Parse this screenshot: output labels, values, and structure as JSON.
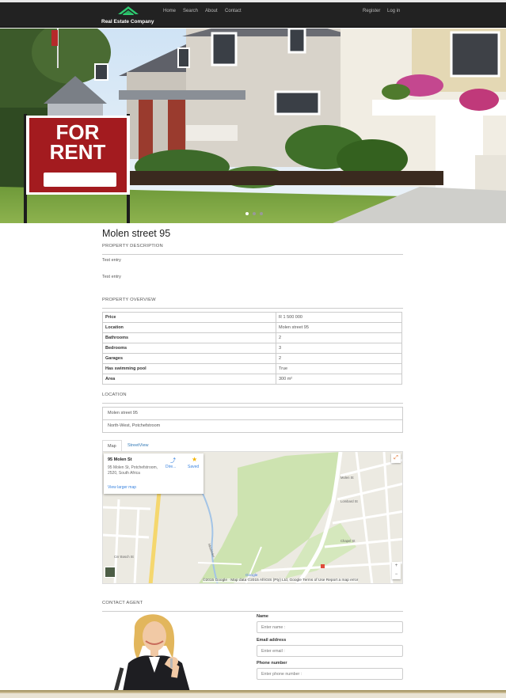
{
  "navbar": {
    "brand": "Real Estate Company",
    "links": [
      "Home",
      "Search",
      "About",
      "Contact"
    ],
    "right_links": [
      "Register",
      "Log in"
    ]
  },
  "hero": {
    "sign_line1": "FOR",
    "sign_line2": "RENT",
    "slide_count": 3,
    "active_slide": 1
  },
  "property": {
    "title": "Molen street 95",
    "description_heading": "PROPERTY DESCRIPTION",
    "description_lines": [
      "Test entry",
      "Test entry"
    ],
    "overview_heading": "PROPERTY OVERVIEW",
    "overview": [
      {
        "label": "Price",
        "value": "R 1 500 000"
      },
      {
        "label": "Location",
        "value": "Molen street 95"
      },
      {
        "label": "Bathrooms",
        "value": "2"
      },
      {
        "label": "Bedrooms",
        "value": "3"
      },
      {
        "label": "Garages",
        "value": "2"
      },
      {
        "label": "Has swimming pool",
        "value": "True"
      },
      {
        "label": "Area",
        "value": "300 m²"
      }
    ]
  },
  "location": {
    "heading": "LOCATION",
    "lines": [
      "Molen street 95",
      "North-West, Potchefstroom"
    ]
  },
  "map": {
    "tabs": [
      "Map",
      "StreetView"
    ],
    "active_tab": "Map",
    "info_name": "95 Molen St",
    "info_address": "95 Molen St, Potchefstroom, 2520, South Africa",
    "info_link": "View larger map",
    "directions_label": "Dire...",
    "saved_label": "Saved",
    "footer": "©2015 Google · Map data ©2015 AfriGIS (Pty) Ltd, Google    Terms of Use    Report a map error",
    "zoom_in": "+",
    "zoom_out": "−",
    "street_labels": [
      "Molen St",
      "Chapel St",
      "Lombard St",
      "Mooirivier",
      "Cnr Bosch St"
    ],
    "google_label": "Google"
  },
  "contact": {
    "heading": "CONTACT AGENT",
    "fields": [
      {
        "label": "Name",
        "placeholder": "Enter name :"
      },
      {
        "label": "Email address",
        "placeholder": "Enter email :"
      },
      {
        "label": "Phone number",
        "placeholder": "Enter phone number :"
      }
    ]
  },
  "colors": {
    "navbar_bg": "#222222",
    "brand_logo": "#2ecc71",
    "link": "#337ab7",
    "sign_red": "#a31b1f"
  }
}
